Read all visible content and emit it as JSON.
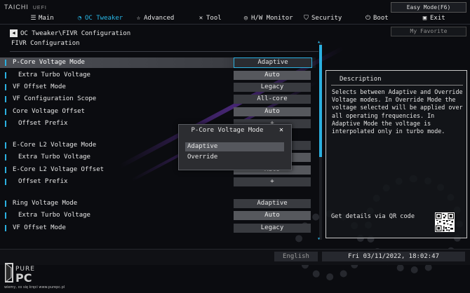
{
  "brand": {
    "name": "TAICHI",
    "sub": "UEFI"
  },
  "header": {
    "mode_button": "Easy Mode(F6)",
    "favorite_button": "My Favorite",
    "nav": [
      {
        "label": "Main",
        "icon": "main-menu-icon",
        "active": false
      },
      {
        "label": "OC Tweaker",
        "icon": "oc-tweaker-icon",
        "active": true
      },
      {
        "label": "Advanced",
        "icon": "advanced-star-icon",
        "active": false
      },
      {
        "label": "Tool",
        "icon": "tool-icon",
        "active": false
      },
      {
        "label": "H/W Monitor",
        "icon": "hw-monitor-icon",
        "active": false
      },
      {
        "label": "Security",
        "icon": "security-shield-icon",
        "active": false
      },
      {
        "label": "Boot",
        "icon": "boot-power-icon",
        "active": false
      },
      {
        "label": "Exit",
        "icon": "exit-door-icon",
        "active": false
      }
    ]
  },
  "breadcrumb": "OC Tweaker\\FIVR Configuration",
  "section_title": "FIVR Configuration",
  "options": [
    {
      "label": "P-Core Voltage Mode",
      "value": "Adaptive",
      "sub": false,
      "selected": true
    },
    {
      "label": "Extra Turbo Voltage",
      "value": "Auto",
      "sub": true,
      "dim": true
    },
    {
      "label": "VF Offset Mode",
      "value": "Legacy",
      "sub": false
    },
    {
      "label": "VF Configuration Scope",
      "value": "All-core",
      "sub": false
    },
    {
      "label": "Core Voltage Offset",
      "value": "Auto",
      "sub": false,
      "dim": true
    },
    {
      "label": "Offset Prefix",
      "value": "+",
      "sub": true
    },
    {
      "label": "E-Core L2 Voltage Mode",
      "value": "Adaptive",
      "sub": false
    },
    {
      "label": "Extra Turbo Voltage",
      "value": "Auto",
      "sub": true,
      "dim": true
    },
    {
      "label": "E-Core L2 Voltage Offset",
      "value": "Auto",
      "sub": false,
      "dim": true
    },
    {
      "label": "Offset Prefix",
      "value": "+",
      "sub": true
    },
    {
      "label": "Ring Voltage Mode",
      "value": "Adaptive",
      "sub": false
    },
    {
      "label": "Extra Turbo Voltage",
      "value": "Auto",
      "sub": true,
      "dim": true
    },
    {
      "label": "VF Offset Mode",
      "value": "Legacy",
      "sub": false
    }
  ],
  "description": {
    "title": "Description",
    "lines": [
      "Selects between Adaptive and Override",
      "Voltage modes. In Override Mode the",
      "voltage selected will be applied over",
      "all operating frequencies. In",
      "Adaptive Mode the voltage is",
      "interpolated only in turbo mode."
    ],
    "qr_text": "Get details via QR code"
  },
  "dialog": {
    "title": "P-Core Voltage Mode",
    "options": [
      "Adaptive",
      "Override"
    ],
    "selected_index": 0
  },
  "footer": {
    "language": "English",
    "datetime": "Fri 03/11/2022, 18:02:47"
  },
  "watermark": {
    "text": "PUREPC",
    "slogan": "wiemy, co się kręci  www.purepc.pl"
  },
  "colors": {
    "accent": "#2bb0e0",
    "background": "#0b0c10"
  }
}
